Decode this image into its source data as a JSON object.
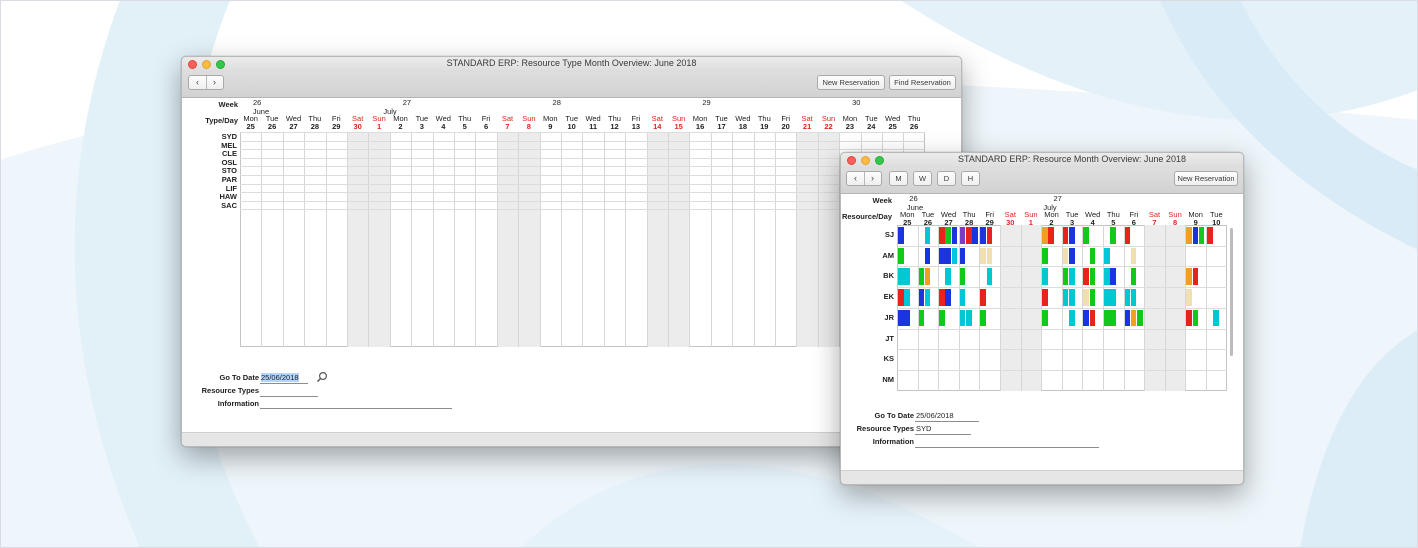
{
  "colors": {
    "accent_red": "#e0251c",
    "weekend_shade": "#ececec",
    "selection": "#b3d4fc",
    "booking_palette": [
      "#1a35e0",
      "#12c81a",
      "#00c8d2",
      "#e8231c",
      "#f0e0b0",
      "#f0a020",
      "#7a3cc8"
    ]
  },
  "window_back": {
    "title": "STANDARD ERP: Resource Type Month Overview: June 2018",
    "nav_prev_icon": "chevron-left-icon",
    "nav_next_icon": "chevron-right-icon",
    "buttons": [
      "New Reservation",
      "Find Reservation"
    ],
    "week_label": "Week",
    "typeday_label": "Type/Day",
    "weeks": [
      "26",
      "27",
      "28",
      "29",
      "30"
    ],
    "months": [
      "June",
      "July"
    ],
    "days": [
      {
        "name": "Mon",
        "num": "25",
        "weekend": false
      },
      {
        "name": "Tue",
        "num": "26",
        "weekend": false
      },
      {
        "name": "Wed",
        "num": "27",
        "weekend": false
      },
      {
        "name": "Thu",
        "num": "28",
        "weekend": false
      },
      {
        "name": "Fri",
        "num": "29",
        "weekend": false
      },
      {
        "name": "Sat",
        "num": "30",
        "weekend": true
      },
      {
        "name": "Sun",
        "num": "1",
        "weekend": true
      },
      {
        "name": "Mon",
        "num": "2",
        "weekend": false
      },
      {
        "name": "Tue",
        "num": "3",
        "weekend": false
      },
      {
        "name": "Wed",
        "num": "4",
        "weekend": false
      },
      {
        "name": "Thu",
        "num": "5",
        "weekend": false
      },
      {
        "name": "Fri",
        "num": "6",
        "weekend": false
      },
      {
        "name": "Sat",
        "num": "7",
        "weekend": true
      },
      {
        "name": "Sun",
        "num": "8",
        "weekend": true
      },
      {
        "name": "Mon",
        "num": "9",
        "weekend": false
      },
      {
        "name": "Tue",
        "num": "10",
        "weekend": false
      },
      {
        "name": "Wed",
        "num": "11",
        "weekend": false
      },
      {
        "name": "Thu",
        "num": "12",
        "weekend": false
      },
      {
        "name": "Fri",
        "num": "13",
        "weekend": false
      },
      {
        "name": "Sat",
        "num": "14",
        "weekend": true
      },
      {
        "name": "Sun",
        "num": "15",
        "weekend": true
      },
      {
        "name": "Mon",
        "num": "16",
        "weekend": false
      },
      {
        "name": "Tue",
        "num": "17",
        "weekend": false
      },
      {
        "name": "Wed",
        "num": "18",
        "weekend": false
      },
      {
        "name": "Thu",
        "num": "19",
        "weekend": false
      },
      {
        "name": "Fri",
        "num": "20",
        "weekend": false
      },
      {
        "name": "Sat",
        "num": "21",
        "weekend": true
      },
      {
        "name": "Sun",
        "num": "22",
        "weekend": true
      },
      {
        "name": "Mon",
        "num": "23",
        "weekend": false
      },
      {
        "name": "Tue",
        "num": "24",
        "weekend": false
      },
      {
        "name": "Wed",
        "num": "25",
        "weekend": false
      },
      {
        "name": "Thu",
        "num": "26",
        "weekend": false
      }
    ],
    "resource_types": [
      "SYD",
      "MEL",
      "CLE",
      "OSL",
      "STO",
      "PAR",
      "LIF",
      "HAW",
      "SAC"
    ],
    "fields": {
      "goto_label": "Go To Date",
      "goto_value": "25/06/2018",
      "goto_icon": "magnifier-icon",
      "resource_types_label": "Resource Types",
      "resource_types_value": "",
      "information_label": "Information",
      "information_value": ""
    }
  },
  "window_front": {
    "title": "STANDARD ERP: Resource Month Overview: June 2018",
    "nav_prev_icon": "chevron-left-icon",
    "nav_next_icon": "chevron-right-icon",
    "view_buttons": [
      "M",
      "W",
      "D",
      "H"
    ],
    "new_reservation": "New Reservation",
    "week_label": "Week",
    "resourceday_label": "Resource/Day",
    "weeks": [
      "26",
      "27"
    ],
    "months": [
      "June",
      "July"
    ],
    "days": [
      {
        "name": "Mon",
        "num": "25",
        "weekend": false
      },
      {
        "name": "Tue",
        "num": "26",
        "weekend": false
      },
      {
        "name": "Wed",
        "num": "27",
        "weekend": false
      },
      {
        "name": "Thu",
        "num": "28",
        "weekend": false
      },
      {
        "name": "Fri",
        "num": "29",
        "weekend": false
      },
      {
        "name": "Sat",
        "num": "30",
        "weekend": true
      },
      {
        "name": "Sun",
        "num": "1",
        "weekend": true
      },
      {
        "name": "Mon",
        "num": "2",
        "weekend": false
      },
      {
        "name": "Tue",
        "num": "3",
        "weekend": false
      },
      {
        "name": "Wed",
        "num": "4",
        "weekend": false
      },
      {
        "name": "Thu",
        "num": "5",
        "weekend": false
      },
      {
        "name": "Fri",
        "num": "6",
        "weekend": false
      },
      {
        "name": "Sat",
        "num": "7",
        "weekend": true
      },
      {
        "name": "Sun",
        "num": "8",
        "weekend": true
      },
      {
        "name": "Mon",
        "num": "9",
        "weekend": false
      },
      {
        "name": "Tue",
        "num": "10",
        "weekend": false
      }
    ],
    "resources": [
      "SJ",
      "AM",
      "BK",
      "EK",
      "JR",
      "JT",
      "KS",
      "NM"
    ],
    "bookings": [
      {
        "resource": "SJ",
        "day": 0,
        "colors": [
          "#1a35e0",
          "#ffffff",
          "#ffffff"
        ]
      },
      {
        "resource": "SJ",
        "day": 1,
        "colors": [
          "#ffffff",
          "#00c8d2",
          "#ffffff"
        ]
      },
      {
        "resource": "SJ",
        "day": 2,
        "colors": [
          "#e8231c",
          "#12c81a",
          "#1a35e0"
        ]
      },
      {
        "resource": "SJ",
        "day": 3,
        "colors": [
          "#7a3cc8",
          "#e8231c",
          "#1a35e0"
        ]
      },
      {
        "resource": "SJ",
        "day": 4,
        "colors": [
          "#1a35e0",
          "#e8231c",
          "#ffffff"
        ]
      },
      {
        "resource": "SJ",
        "day": 7,
        "colors": [
          "#f0a020",
          "#e8231c",
          "#ffffff"
        ]
      },
      {
        "resource": "SJ",
        "day": 8,
        "colors": [
          "#e8231c",
          "#1a35e0",
          "#ffffff"
        ]
      },
      {
        "resource": "SJ",
        "day": 9,
        "colors": [
          "#12c81a",
          "#ffffff",
          "#ffffff"
        ]
      },
      {
        "resource": "SJ",
        "day": 10,
        "colors": [
          "#ffffff",
          "#12c81a",
          "#ffffff"
        ]
      },
      {
        "resource": "SJ",
        "day": 11,
        "colors": [
          "#e8231c",
          "#ffffff",
          "#ffffff"
        ]
      },
      {
        "resource": "SJ",
        "day": 14,
        "colors": [
          "#f0a020",
          "#1a35e0",
          "#12c81a"
        ]
      },
      {
        "resource": "SJ",
        "day": 15,
        "colors": [
          "#e8231c",
          "#ffffff",
          "#ffffff"
        ]
      },
      {
        "resource": "AM",
        "day": 0,
        "colors": [
          "#12c81a",
          "#ffffff",
          "#ffffff"
        ]
      },
      {
        "resource": "AM",
        "day": 1,
        "colors": [
          "#ffffff",
          "#1a35e0",
          "#ffffff"
        ]
      },
      {
        "resource": "AM",
        "day": 2,
        "colors": [
          "#1a35e0",
          "#1a35e0",
          "#00c8d2"
        ]
      },
      {
        "resource": "AM",
        "day": 3,
        "colors": [
          "#1a35e0",
          "#ffffff",
          "#ffffff"
        ]
      },
      {
        "resource": "AM",
        "day": 4,
        "colors": [
          "#f0e0b0",
          "#f0e0b0",
          "#ffffff"
        ]
      },
      {
        "resource": "AM",
        "day": 7,
        "colors": [
          "#12c81a",
          "#ffffff",
          "#ffffff"
        ]
      },
      {
        "resource": "AM",
        "day": 8,
        "colors": [
          "#f0e0b0",
          "#1a35e0",
          "#ffffff"
        ]
      },
      {
        "resource": "AM",
        "day": 9,
        "colors": [
          "#ffffff",
          "#12c81a",
          "#ffffff"
        ]
      },
      {
        "resource": "AM",
        "day": 10,
        "colors": [
          "#00c8d2",
          "#ffffff",
          "#ffffff"
        ]
      },
      {
        "resource": "AM",
        "day": 11,
        "colors": [
          "#ffffff",
          "#f0e0b0",
          "#ffffff"
        ]
      },
      {
        "resource": "BK",
        "day": 0,
        "colors": [
          "#00c8d2",
          "#00c8d2",
          "#ffffff"
        ]
      },
      {
        "resource": "BK",
        "day": 1,
        "colors": [
          "#12c81a",
          "#f0a020",
          "#ffffff"
        ]
      },
      {
        "resource": "BK",
        "day": 2,
        "colors": [
          "#ffffff",
          "#00c8d2",
          "#ffffff"
        ]
      },
      {
        "resource": "BK",
        "day": 3,
        "colors": [
          "#12c81a",
          "#ffffff",
          "#ffffff"
        ]
      },
      {
        "resource": "BK",
        "day": 4,
        "colors": [
          "#ffffff",
          "#00c8d2",
          "#ffffff"
        ]
      },
      {
        "resource": "BK",
        "day": 7,
        "colors": [
          "#00c8d2",
          "#ffffff",
          "#ffffff"
        ]
      },
      {
        "resource": "BK",
        "day": 8,
        "colors": [
          "#12c81a",
          "#00c8d2",
          "#ffffff"
        ]
      },
      {
        "resource": "BK",
        "day": 9,
        "colors": [
          "#e8231c",
          "#12c81a",
          "#ffffff"
        ]
      },
      {
        "resource": "BK",
        "day": 10,
        "colors": [
          "#00c8d2",
          "#1a35e0",
          "#ffffff"
        ]
      },
      {
        "resource": "BK",
        "day": 11,
        "colors": [
          "#ffffff",
          "#12c81a",
          "#ffffff"
        ]
      },
      {
        "resource": "BK",
        "day": 14,
        "colors": [
          "#f0a020",
          "#e8231c",
          "#ffffff"
        ]
      },
      {
        "resource": "EK",
        "day": 0,
        "colors": [
          "#e8231c",
          "#00c8d2",
          "#ffffff"
        ]
      },
      {
        "resource": "EK",
        "day": 1,
        "colors": [
          "#1a35e0",
          "#00c8d2",
          "#ffffff"
        ]
      },
      {
        "resource": "EK",
        "day": 2,
        "colors": [
          "#e8231c",
          "#1a35e0",
          "#ffffff"
        ]
      },
      {
        "resource": "EK",
        "day": 3,
        "colors": [
          "#00c8d2",
          "#ffffff",
          "#ffffff"
        ]
      },
      {
        "resource": "EK",
        "day": 4,
        "colors": [
          "#e8231c",
          "#ffffff",
          "#ffffff"
        ]
      },
      {
        "resource": "EK",
        "day": 7,
        "colors": [
          "#e8231c",
          "#ffffff",
          "#ffffff"
        ]
      },
      {
        "resource": "EK",
        "day": 8,
        "colors": [
          "#00c8d2",
          "#00c8d2",
          "#ffffff"
        ]
      },
      {
        "resource": "EK",
        "day": 9,
        "colors": [
          "#f0e0b0",
          "#12c81a",
          "#ffffff"
        ]
      },
      {
        "resource": "EK",
        "day": 10,
        "colors": [
          "#00c8d2",
          "#00c8d2",
          "#ffffff"
        ]
      },
      {
        "resource": "EK",
        "day": 11,
        "colors": [
          "#00c8d2",
          "#00c8d2",
          "#ffffff"
        ]
      },
      {
        "resource": "EK",
        "day": 14,
        "colors": [
          "#f0e0b0",
          "#ffffff",
          "#ffffff"
        ]
      },
      {
        "resource": "JR",
        "day": 0,
        "colors": [
          "#1a35e0",
          "#1a35e0",
          "#ffffff"
        ]
      },
      {
        "resource": "JR",
        "day": 1,
        "colors": [
          "#12c81a",
          "#ffffff",
          "#ffffff"
        ]
      },
      {
        "resource": "JR",
        "day": 2,
        "colors": [
          "#12c81a",
          "#ffffff",
          "#ffffff"
        ]
      },
      {
        "resource": "JR",
        "day": 3,
        "colors": [
          "#00c8d2",
          "#00c8d2",
          "#ffffff"
        ]
      },
      {
        "resource": "JR",
        "day": 4,
        "colors": [
          "#12c81a",
          "#ffffff",
          "#ffffff"
        ]
      },
      {
        "resource": "JR",
        "day": 7,
        "colors": [
          "#12c81a",
          "#ffffff",
          "#ffffff"
        ]
      },
      {
        "resource": "JR",
        "day": 8,
        "colors": [
          "#ffffff",
          "#00c8d2",
          "#ffffff"
        ]
      },
      {
        "resource": "JR",
        "day": 9,
        "colors": [
          "#1a35e0",
          "#e8231c",
          "#ffffff"
        ]
      },
      {
        "resource": "JR",
        "day": 10,
        "colors": [
          "#12c81a",
          "#12c81a",
          "#ffffff"
        ]
      },
      {
        "resource": "JR",
        "day": 11,
        "colors": [
          "#1a35e0",
          "#f0a020",
          "#12c81a"
        ]
      },
      {
        "resource": "JR",
        "day": 14,
        "colors": [
          "#e8231c",
          "#12c81a",
          "#ffffff"
        ]
      },
      {
        "resource": "JR",
        "day": 15,
        "colors": [
          "#ffffff",
          "#00c8d2",
          "#ffffff"
        ]
      }
    ],
    "fields": {
      "goto_label": "Go To Date",
      "goto_value": "25/06/2018",
      "resource_types_label": "Resource Types",
      "resource_types_value": "SYD",
      "information_label": "Information",
      "information_value": ""
    }
  }
}
